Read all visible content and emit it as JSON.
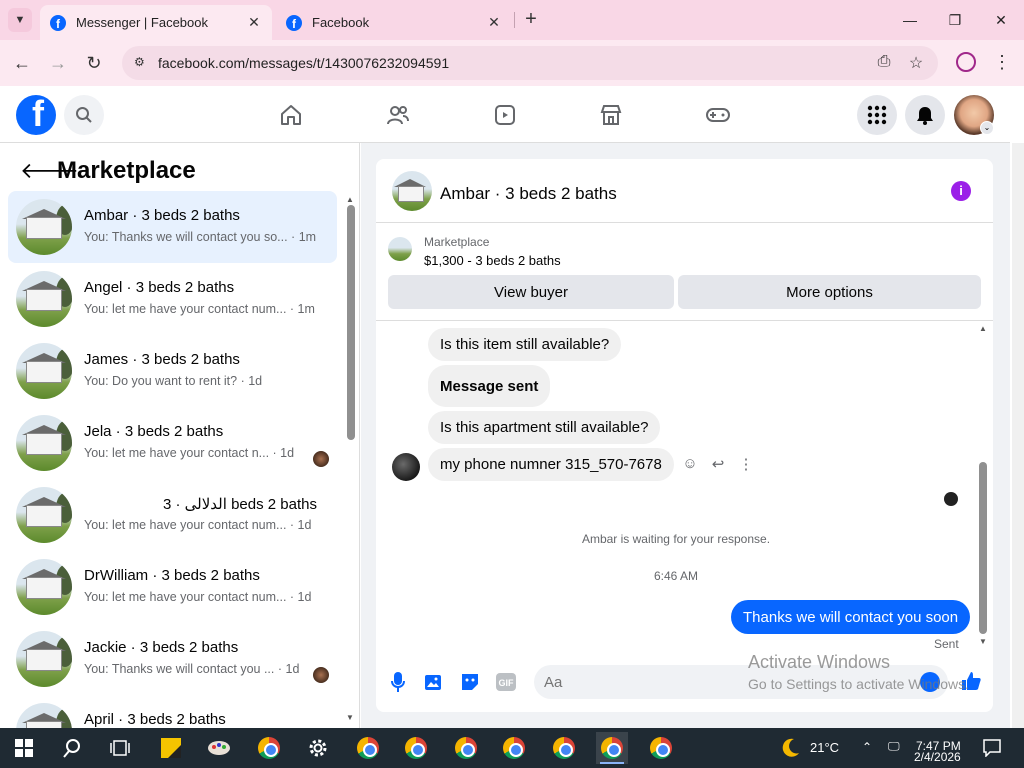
{
  "browser": {
    "tabs": [
      {
        "title": "Messenger | Facebook",
        "active": true
      },
      {
        "title": "Facebook",
        "active": false
      }
    ],
    "url": "facebook.com/messages/t/1430076232094591"
  },
  "left_panel": {
    "title": "Marketplace",
    "conversations": [
      {
        "name": "Ambar · 3 beds 2 baths",
        "preview": "You: Thanks we will contact you so... · 1m",
        "selected": true
      },
      {
        "name": "Angel · 3 beds 2 baths",
        "preview": "You: let me have your contact num... · 1m"
      },
      {
        "name": "James · 3 beds 2 baths",
        "preview": "You: Do you want to rent it? · 1d"
      },
      {
        "name": "Jela · 3 beds 2 baths",
        "preview": "You: let me have your contact n...   · 1d"
      },
      {
        "name": "الدلالی · 3 beds 2 baths",
        "preview": "You: let me have your contact num... · 1d"
      },
      {
        "name": "DrWilliam · 3 beds 2 baths",
        "preview": "You: let me have your contact num... · 1d"
      },
      {
        "name": "Jackie · 3 beds 2 baths",
        "preview": "You: Thanks we will contact you ... · 1d"
      },
      {
        "name": "April · 3 beds 2 baths",
        "preview": ""
      }
    ]
  },
  "chat": {
    "name": "Ambar · 3 beds 2 baths",
    "marketplace_label": "Marketplace",
    "listing": "$1,300 - 3 beds 2 baths",
    "view_buyer_label": "View buyer",
    "more_options_label": "More options",
    "messages": [
      {
        "text": "Is this item still available?",
        "direction": "incoming"
      },
      {
        "text": "Message sent",
        "direction": "incoming",
        "bold": true
      },
      {
        "text": "Is this apartment still available?",
        "direction": "incoming"
      },
      {
        "text": "my phone numner 315_570-7678",
        "direction": "incoming"
      }
    ],
    "waiting_text": "Ambar is waiting for your response.",
    "time": "6:46 AM",
    "outgoing_message": "Thanks we will contact you soon",
    "sent_label": "Sent",
    "composer_placeholder": "Aa"
  },
  "watermark": {
    "title": "Activate Windows",
    "subtitle": "Go to Settings to activate Windows."
  },
  "taskbar": {
    "temperature": "21°C",
    "time": "7:47 PM",
    "date": "2/4/2026"
  },
  "colors": {
    "facebook_blue": "#0866ff",
    "selected_row": "#e7f1fe",
    "tab_bar": "#f9d7e6",
    "info_purple": "#9b1fe8"
  }
}
